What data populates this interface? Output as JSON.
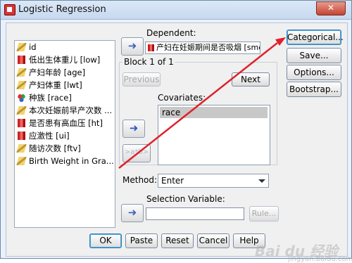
{
  "window": {
    "title": "Logistic Regression",
    "close_label": "✕"
  },
  "variables": [
    {
      "label": "id",
      "icon": "scale-icon"
    },
    {
      "label": "低出生体重儿 [low]",
      "icon": "ordinal-icon"
    },
    {
      "label": "产妇年龄 [age]",
      "icon": "scale-icon"
    },
    {
      "label": "产妇体重 [lwt]",
      "icon": "scale-icon"
    },
    {
      "label": "种族 [race]",
      "icon": "nominal-icon"
    },
    {
      "label": "本次妊娠前早产次数 ...",
      "icon": "scale-icon"
    },
    {
      "label": "是否患有高血压 [ht]",
      "icon": "ordinal-icon"
    },
    {
      "label": "应激性 [ui]",
      "icon": "ordinal-icon"
    },
    {
      "label": "随访次数 [ftv]",
      "icon": "scale-icon"
    },
    {
      "label": "Birth Weight in Gra...",
      "icon": "scale-icon"
    }
  ],
  "dependent": {
    "label": "Dependent:",
    "value": "产妇在妊娠期间是否吸烟 [smo..."
  },
  "block": {
    "title": "Block 1 of 1",
    "previous_label": "Previous",
    "next_label": "Next"
  },
  "covariates": {
    "label": "Covariates:",
    "items": [
      "race"
    ],
    "interaction_label": ">a*b>"
  },
  "method": {
    "label": "Method:",
    "value": "Enter"
  },
  "selection": {
    "label": "Selection Variable:",
    "rule_label": "Rule..."
  },
  "side_buttons": {
    "categorical": "Categorical...",
    "save": "Save...",
    "options": "Options...",
    "bootstrap": "Bootstrap..."
  },
  "bottom_buttons": {
    "ok": "OK",
    "paste": "Paste",
    "reset": "Reset",
    "cancel": "Cancel",
    "help": "Help"
  },
  "watermark": {
    "text": "Bai du 经验",
    "sub": "jingyan.baidu.com"
  },
  "annotation": {
    "arrow_color": "#e0202a"
  }
}
